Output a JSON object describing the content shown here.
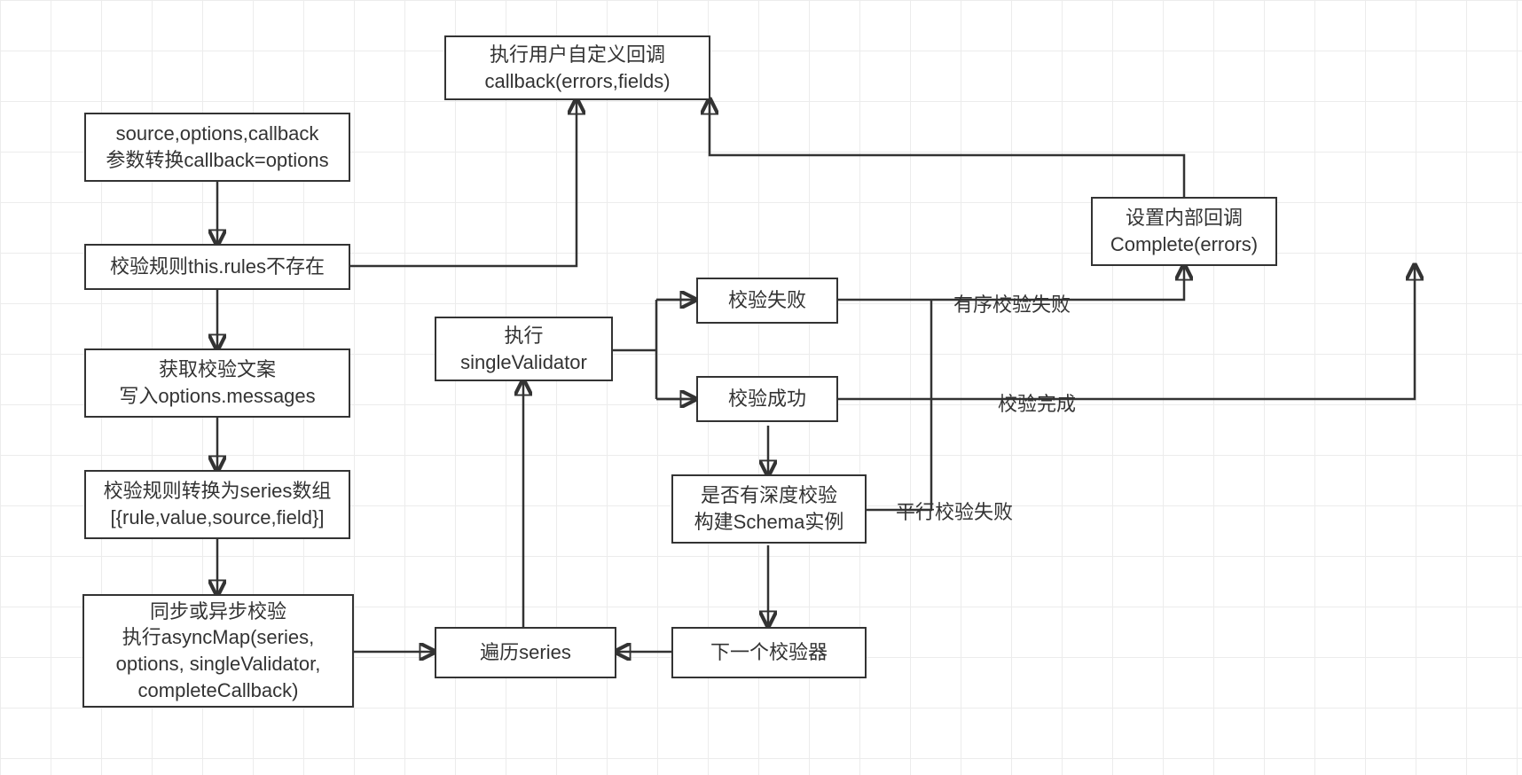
{
  "nodes": {
    "callbackUser": "执行用户自定义回调\ncallback(errors,fields)",
    "paramConvert": "source,options,callback\n参数转换callback=options",
    "rulesMissing": "校验规则this.rules不存在",
    "setInternalCb": "设置内部回调\nComplete(errors)",
    "getMessages": "获取校验文案\n写入options.messages",
    "toSeriesArray": "校验规则转换为series数组\n[{rule,value,source,field}]",
    "asyncMap": "同步或异步校验\n执行asyncMap(series,\noptions, singleValidator,\ncompleteCallback)",
    "iterateSeries": "遍历series",
    "singleValidator": "执行\nsingleValidator",
    "validateFail": "校验失败",
    "validateSuccess": "校验成功",
    "deepValidate": "是否有深度校验\n构建Schema实例",
    "nextValidator": "下一个校验器"
  },
  "edgeLabels": {
    "orderedFail": "有序校验失败",
    "validateDone": "校验完成",
    "parallelFail": "平行校验失败"
  }
}
